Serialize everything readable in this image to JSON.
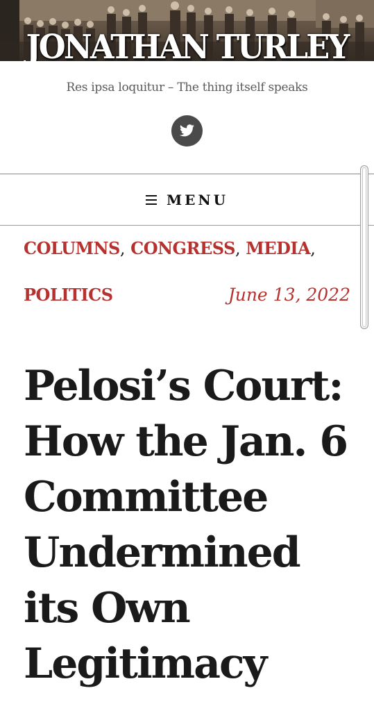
{
  "header": {
    "site_title": "JONATHAN TURLEY",
    "tagline": "Res ipsa loquitur – The thing itself speaks",
    "social_icon": "twitter-icon"
  },
  "nav": {
    "menu_label": "MENU",
    "menu_icon": "hamburger-icon"
  },
  "post": {
    "categories": [
      "COLUMNS",
      "CONGRESS",
      "MEDIA",
      "POLITICS"
    ],
    "date": "June 13, 2022",
    "title": "Pelosi’s Court: How the Jan. 6 Committee Undermined its Own Legitimacy"
  },
  "colors": {
    "accent": "#b5322f",
    "text": "#1a1a1a",
    "icon_bg": "#4a4a4a"
  }
}
